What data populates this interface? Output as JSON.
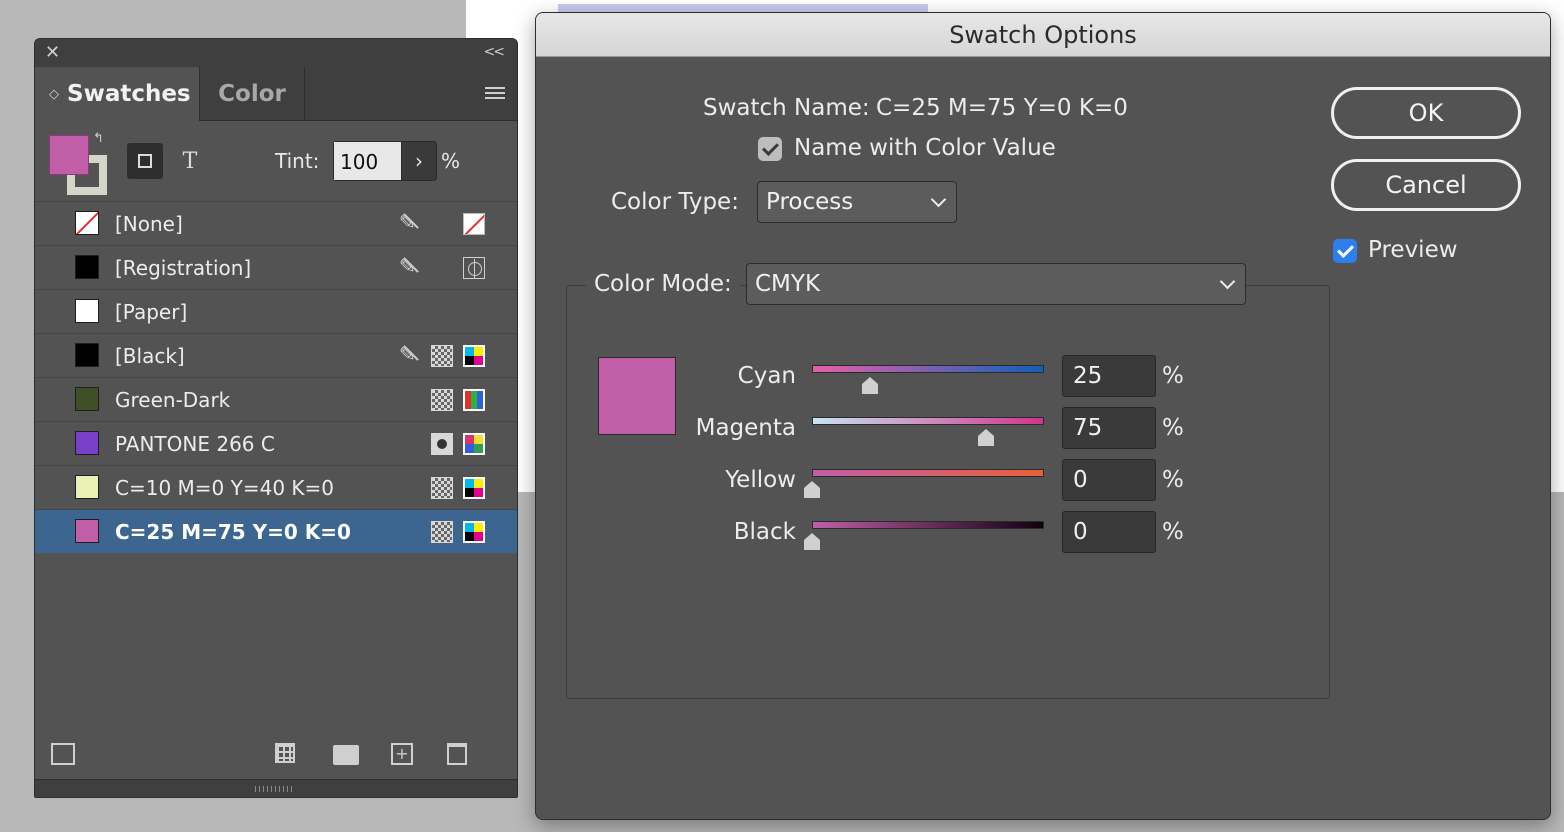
{
  "swatches_panel": {
    "tabs": [
      {
        "label": "Swatches"
      },
      {
        "label": "Color"
      }
    ],
    "tint_label": "Tint:",
    "tint_value": "100",
    "tint_unit": "%",
    "fill_color": "#c05ea8",
    "items": [
      {
        "name": "[None]",
        "chip": "none",
        "color": "#ffffff"
      },
      {
        "name": "[Registration]",
        "chip": "solid",
        "color": "#000000"
      },
      {
        "name": "[Paper]",
        "chip": "solid",
        "color": "#ffffff"
      },
      {
        "name": "[Black]",
        "chip": "solid",
        "color": "#000000"
      },
      {
        "name": "Green-Dark",
        "chip": "solid",
        "color": "#3f4f28"
      },
      {
        "name": "PANTONE 266 C",
        "chip": "solid",
        "color": "#7a3fc8"
      },
      {
        "name": "C=10 M=0 Y=40 K=0",
        "chip": "solid",
        "color": "#ebf0b4"
      },
      {
        "name": "C=25 M=75 Y=0 K=0",
        "chip": "solid",
        "color": "#c05ea8",
        "selected": true
      }
    ]
  },
  "dialog": {
    "title": "Swatch Options",
    "swatch_name_label": "Swatch Name:",
    "swatch_name_value": "C=25 M=75 Y=0 K=0",
    "name_with_color_label": "Name with Color Value",
    "color_type_label": "Color Type:",
    "color_type_value": "Process",
    "color_mode_label": "Color Mode:",
    "color_mode_value": "CMYK",
    "ok_label": "OK",
    "cancel_label": "Cancel",
    "preview_label": "Preview",
    "preview_color": "#c05ea8",
    "sliders": [
      {
        "label": "Cyan",
        "value": "25",
        "level": 0.25,
        "unit": "%"
      },
      {
        "label": "Magenta",
        "value": "75",
        "level": 0.75,
        "unit": "%"
      },
      {
        "label": "Yellow",
        "value": "0",
        "level": 0.0,
        "unit": "%"
      },
      {
        "label": "Black",
        "value": "0",
        "level": 0.0,
        "unit": "%"
      }
    ]
  }
}
